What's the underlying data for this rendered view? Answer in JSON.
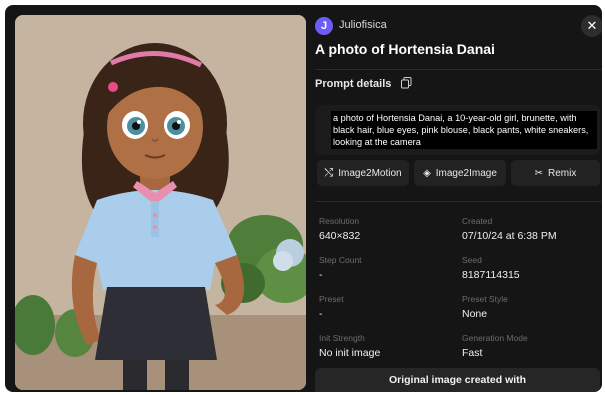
{
  "user": {
    "initial": "J",
    "name": "Juliofisica"
  },
  "title": "A photo of Hortensia Danai",
  "close_icon": "close-icon",
  "prompt": {
    "label": "Prompt details",
    "copy_icon": "copy-icon",
    "text": "a photo of Hortensia Danai, a 10-year-old girl, brunette, with black hair, blue eyes, pink blouse, black pants, white sneakers, looking at the camera"
  },
  "actions": [
    {
      "label": "Image2Motion",
      "icon": "motion-icon"
    },
    {
      "label": "Image2Image",
      "icon": "layers-icon"
    },
    {
      "label": "Remix",
      "icon": "shuffle-icon"
    }
  ],
  "fields": {
    "resolution": {
      "label": "Resolution",
      "value": "640×832"
    },
    "created": {
      "label": "Created",
      "value": "07/10/24 at 6:38 PM"
    },
    "step_count": {
      "label": "Step Count",
      "value": "-"
    },
    "seed": {
      "label": "Seed",
      "value": "8187114315"
    },
    "preset": {
      "label": "Preset",
      "value": "-"
    },
    "preset_style": {
      "label": "Preset Style",
      "value": "None"
    },
    "init_strength": {
      "label": "Init Strength",
      "value": "No init image"
    },
    "generation_mode": {
      "label": "Generation Mode",
      "value": "Fast"
    }
  },
  "bottom_button": "Original image created with",
  "colors": {
    "background": "#151515",
    "accent": "#6d5df6",
    "button": "#222222"
  }
}
